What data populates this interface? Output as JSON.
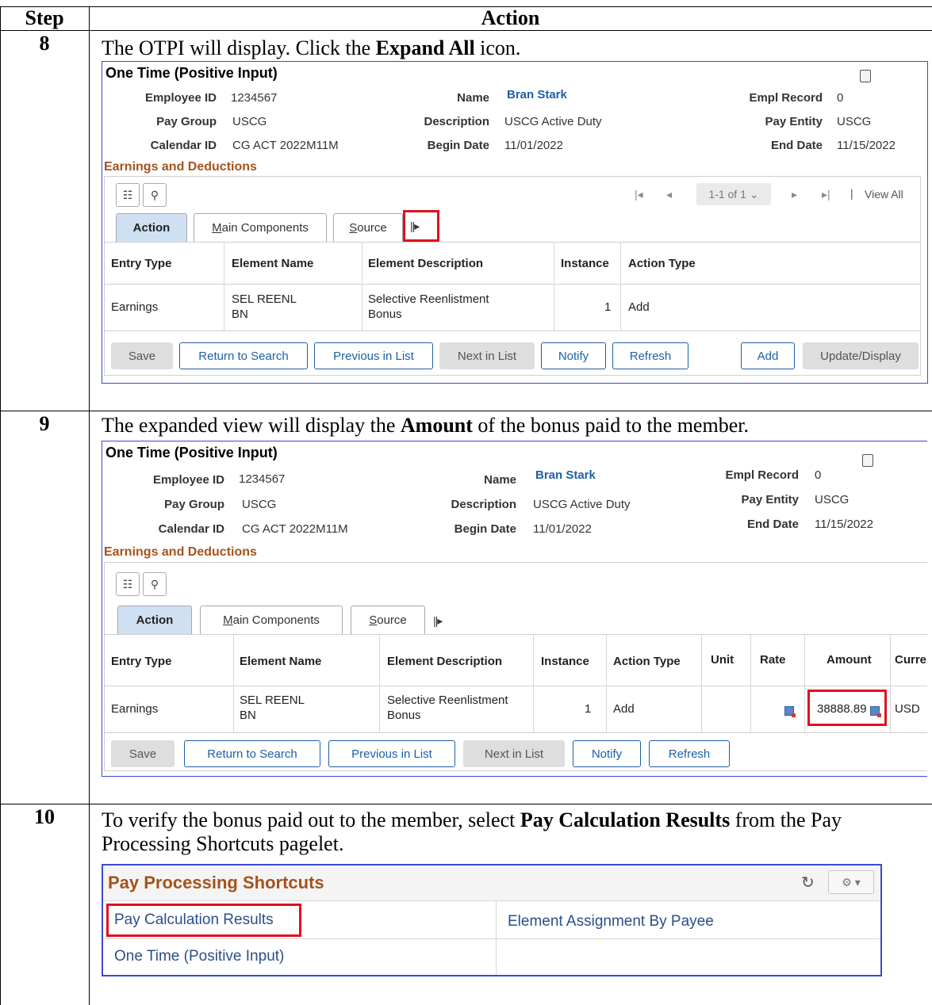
{
  "table": {
    "col_step": "Step",
    "col_action": "Action"
  },
  "steps": [
    {
      "num": "8",
      "text_before": "The OTPI will display. Click the ",
      "bold": "Expand All",
      "text_after": " icon."
    },
    {
      "num": "9",
      "text_before": "The expanded view will display the ",
      "bold": "Amount",
      "text_after": " of the bonus paid to the member."
    },
    {
      "num": "10",
      "text_before": "To verify the bonus paid out to the member, select ",
      "bold": "Pay Calculation Results",
      "text_after": " from the Pay Processing Shortcuts pagelet."
    }
  ],
  "otpi": {
    "title": "One Time (Positive Input)",
    "labels": {
      "employee_id": "Employee ID",
      "pay_group": "Pay Group",
      "calendar_id": "Calendar ID",
      "name": "Name",
      "description": "Description",
      "begin_date": "Begin Date",
      "empl_record": "Empl Record",
      "pay_entity": "Pay Entity",
      "end_date": "End Date"
    },
    "values": {
      "employee_id": "1234567",
      "pay_group": "USCG",
      "calendar_id": "CG ACT 2022M11M",
      "name": "Bran Stark",
      "description": "USCG Active Duty",
      "begin_date": "11/01/2022",
      "empl_record": "0",
      "pay_entity": "USCG",
      "end_date": "11/15/2022"
    },
    "section": "Earnings and Deductions",
    "pager": {
      "range": "1-1 of 1",
      "view_all": "View All"
    },
    "tabs": {
      "action": "Action",
      "main_components_m": "M",
      "main_components_rest": "ain Components",
      "source_s": "S",
      "source_rest": "ource"
    },
    "columns": {
      "entry_type": "Entry Type",
      "element_name": "Element Name",
      "element_description": "Element Description",
      "instance": "Instance",
      "action_type": "Action Type",
      "unit": "Unit",
      "rate": "Rate",
      "amount": "Amount",
      "currency": "Curre"
    },
    "row": {
      "entry_type": "Earnings",
      "element_name_1": "SEL REENL",
      "element_name_2": "BN",
      "element_description_1": "Selective Reenlistment",
      "element_description_2": "Bonus",
      "instance": "1",
      "action_type": "Add",
      "amount": "38888.89",
      "currency": "USD"
    },
    "buttons": {
      "save": "Save",
      "return_to_search": "Return to Search",
      "previous_in_list": "Previous in List",
      "next_in_list": "Next in List",
      "notify": "Notify",
      "refresh": "Refresh",
      "add": "Add",
      "update_display": "Update/Display"
    }
  },
  "pps": {
    "title": "Pay Processing Shortcuts",
    "links": [
      "Pay Calculation Results",
      "Element Assignment By Payee",
      "One Time (Positive Input)"
    ]
  }
}
